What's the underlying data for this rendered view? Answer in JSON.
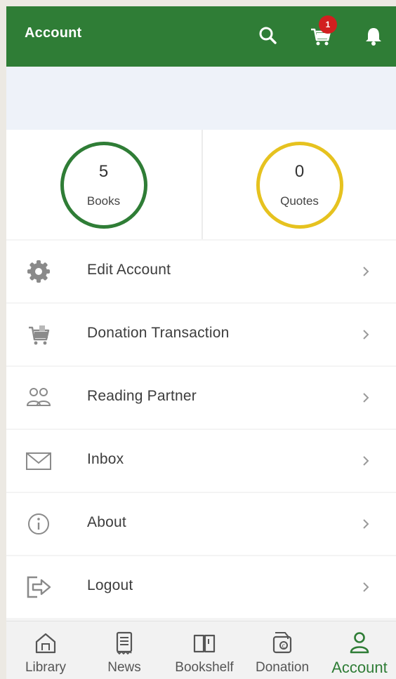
{
  "header": {
    "title": "Account",
    "cart_badge": "1",
    "icons": [
      "search-icon",
      "cart-icon",
      "bell-icon"
    ],
    "color": "#2f7d36"
  },
  "stats": {
    "books": {
      "value": "5",
      "label": "Books",
      "ring_color": "#2f7d36"
    },
    "quotes": {
      "value": "0",
      "label": "Quotes",
      "ring_color": "#e6c21f"
    }
  },
  "menu": {
    "items": [
      {
        "label": "Edit Account",
        "icon": "gear-icon"
      },
      {
        "label": "Donation Transaction",
        "icon": "cart-icon"
      },
      {
        "label": "Reading Partner",
        "icon": "people-icon"
      },
      {
        "label": "Inbox",
        "icon": "envelope-icon"
      },
      {
        "label": "About",
        "icon": "info-icon"
      },
      {
        "label": "Logout",
        "icon": "logout-icon"
      }
    ]
  },
  "bottom_nav": {
    "tabs": [
      {
        "label": "Library",
        "icon": "home-icon"
      },
      {
        "label": "News",
        "icon": "news-icon"
      },
      {
        "label": "Bookshelf",
        "icon": "book-icon"
      },
      {
        "label": "Donation",
        "icon": "wallet-icon"
      },
      {
        "label": "Account",
        "icon": "user-icon"
      }
    ],
    "active": "Account",
    "active_color": "#2f7d36"
  }
}
